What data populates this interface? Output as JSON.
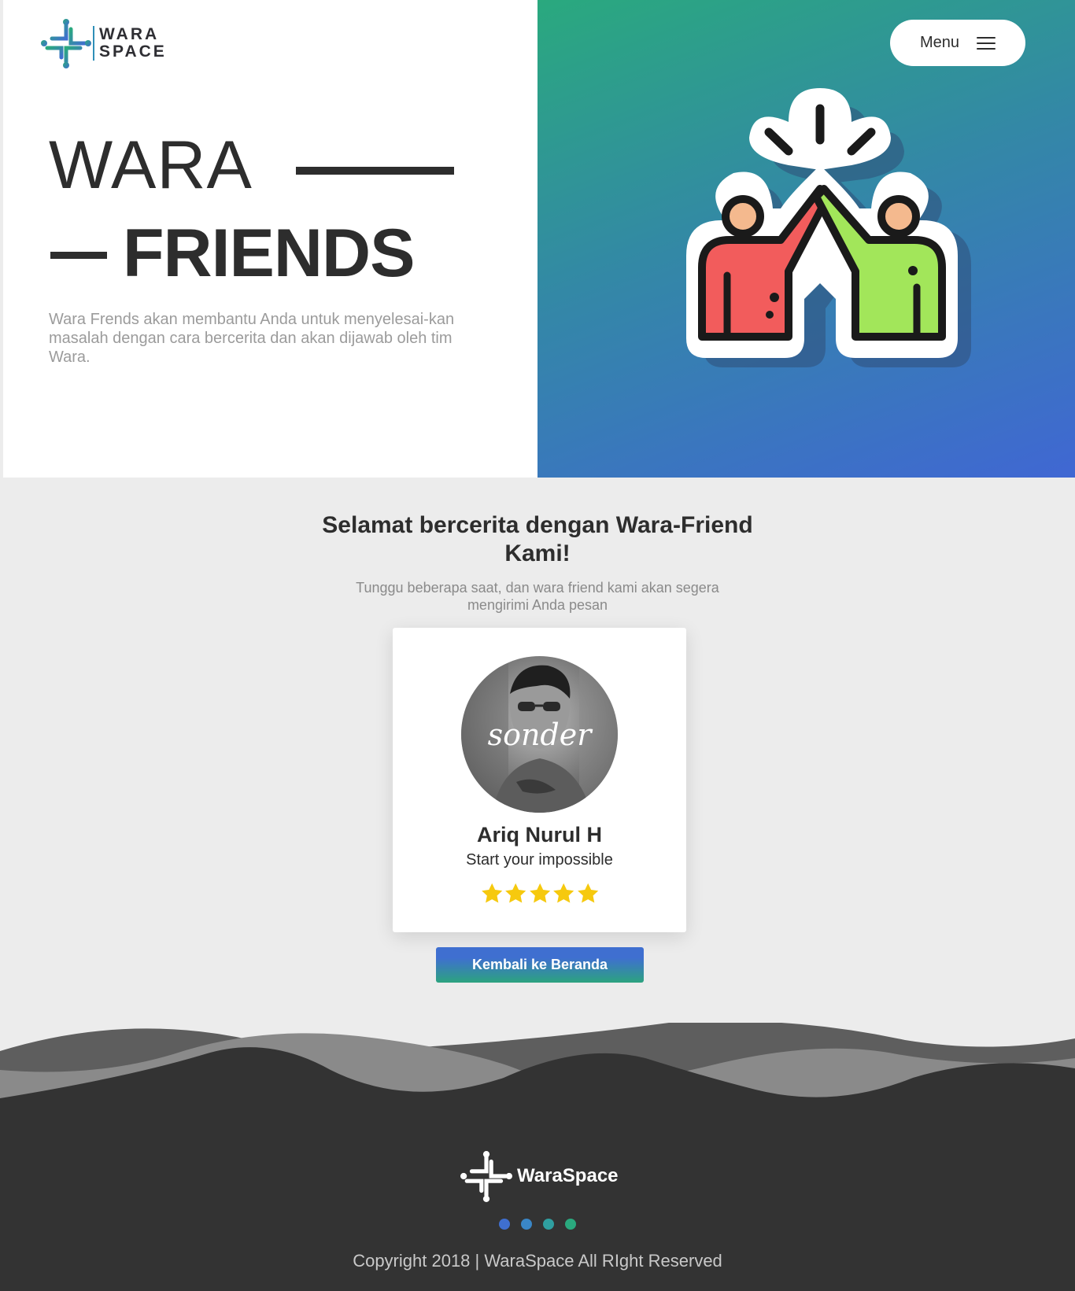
{
  "brand": {
    "logo_word_1": "WARA",
    "logo_word_2": "SPACE",
    "footer_name": "WaraSpace"
  },
  "header": {
    "menu_label": "Menu"
  },
  "hero": {
    "title_line_1": "WARA",
    "title_line_2": "FRIENDS",
    "description": "Wara Frends akan membantu Anda untuk menyelesai-kan masalah dengan cara bercerita dan akan dijawab oleh tim Wara."
  },
  "main": {
    "title": "Selamat bercerita dengan Wara-Friend Kami!",
    "subtitle": "Tunggu beberapa saat, dan wara friend kami akan segera mengirimi Anda pesan",
    "back_button": "Kembali ke Beranda"
  },
  "friend_card": {
    "avatar_caption": "sonder",
    "name": "Ariq Nurul H",
    "tagline": "Start your impossible",
    "rating": 5,
    "rating_max": 5
  },
  "footer": {
    "copyright": "Copyright 2018 | WaraSpace All RIght Reserved",
    "dot_colors": [
      "#3f6fd0",
      "#3a86c6",
      "#2f9fa0",
      "#2aa97e"
    ]
  },
  "colors": {
    "accent_blue": "#4067d3",
    "accent_green": "#2aa97e",
    "star": "#f6c90e",
    "dark": "#2d2d2d",
    "footer_bg": "#333333"
  }
}
